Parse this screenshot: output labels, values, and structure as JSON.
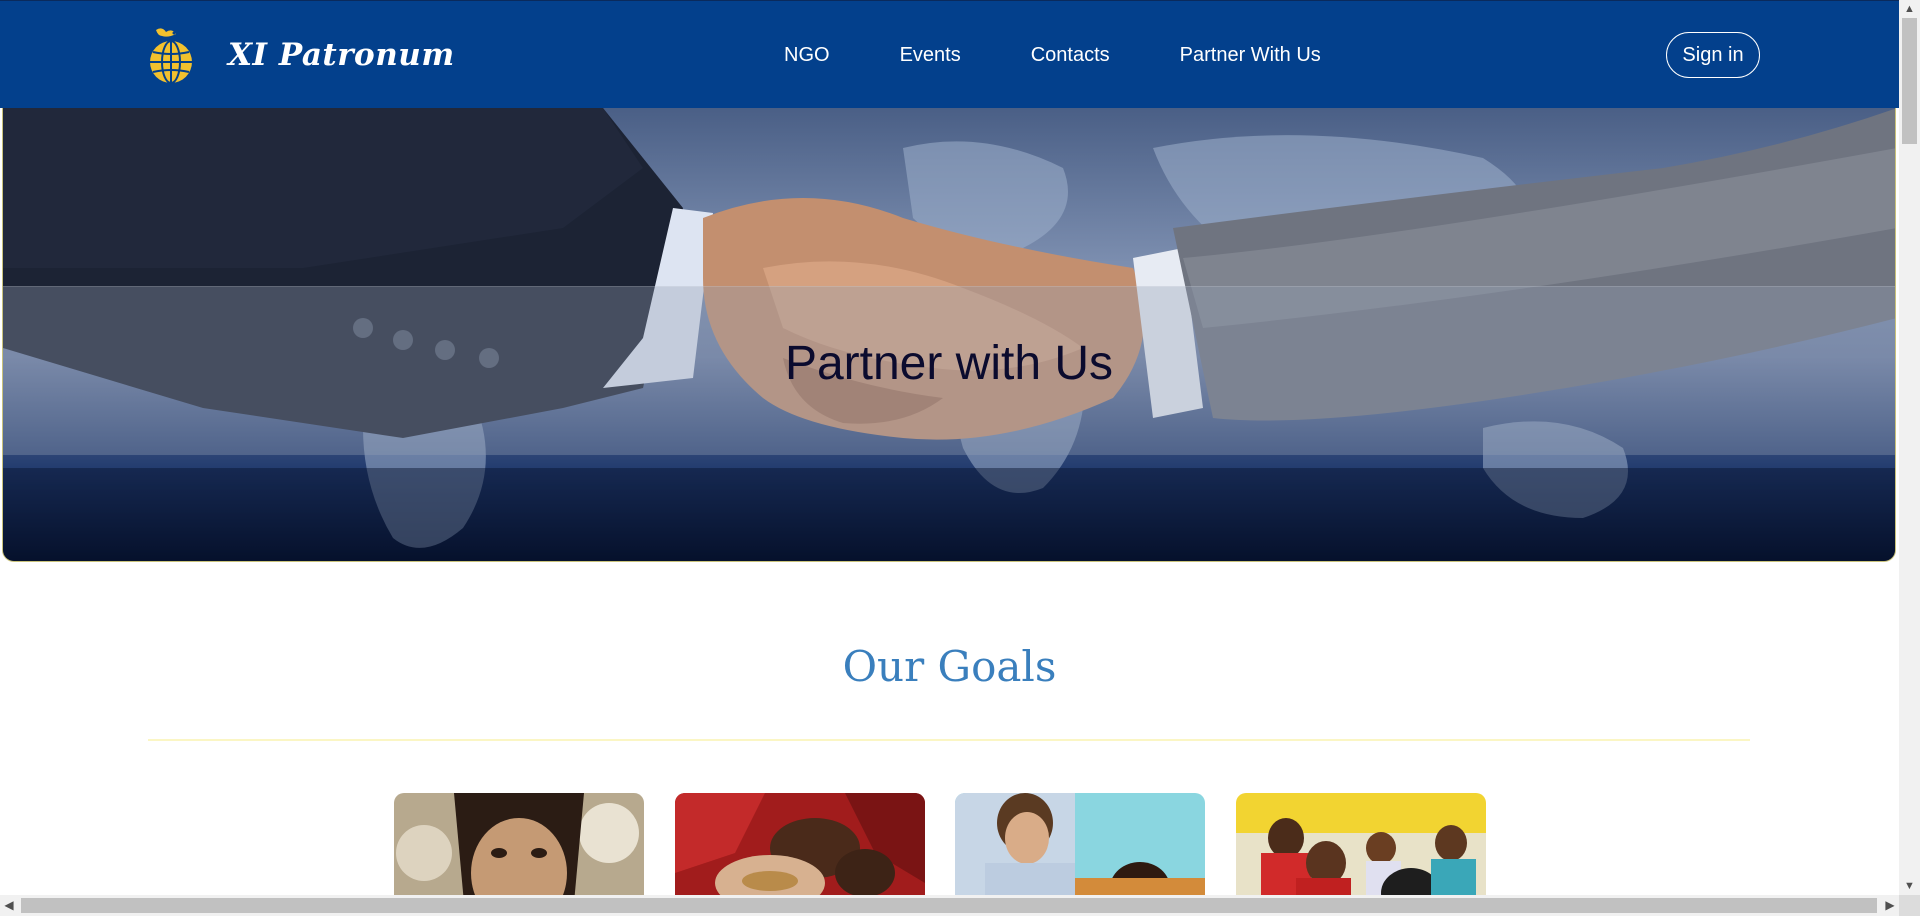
{
  "brand": {
    "name": "XI Patronum",
    "logo_icon": "globe-dove-logo-icon"
  },
  "nav": {
    "items": [
      {
        "label": "NGO"
      },
      {
        "label": "Events"
      },
      {
        "label": "Contacts"
      },
      {
        "label": "Partner With Us"
      }
    ],
    "signin_label": "Sign in"
  },
  "hero": {
    "title": "Partner with Us",
    "image": "handshake-over-world-map"
  },
  "goals": {
    "title": "Our Goals",
    "cards": [
      {
        "image": "child-portrait"
      },
      {
        "image": "hands-holding-grain"
      },
      {
        "image": "teacher-with-student"
      },
      {
        "image": "children-in-classroom"
      }
    ]
  },
  "colors": {
    "navbar": "#03408c",
    "goals_title": "#3a7fbd",
    "divider": "#fbf6c4",
    "hero_title": "#0b0b2e"
  },
  "scrollbars": {
    "up_icon": "scroll-up-arrow-icon",
    "down_icon": "scroll-down-arrow-icon",
    "left_icon": "scroll-left-arrow-icon",
    "right_icon": "scroll-right-arrow-icon"
  }
}
